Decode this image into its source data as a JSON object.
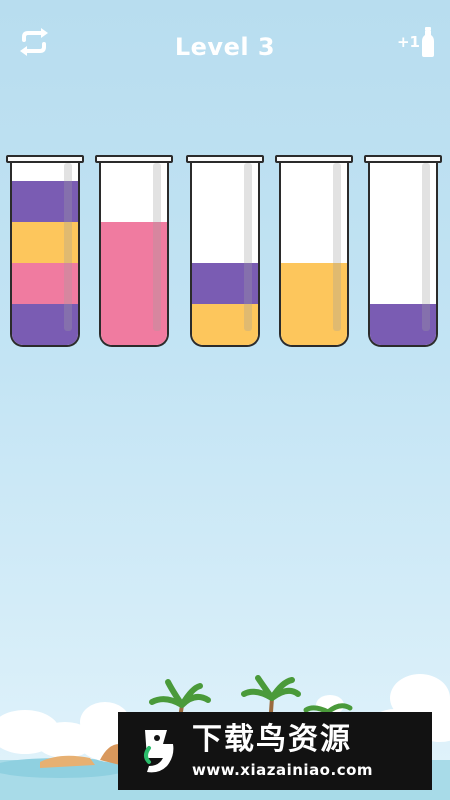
{
  "header": {
    "title": "Level 3",
    "add_tube_label": "+1",
    "restart_icon": "restart-icon",
    "bottle_icon": "bottle-icon"
  },
  "colors": {
    "purple": "#7a5cb3",
    "yellow": "#fdc65c",
    "pink": "#f07ba0",
    "empty": "#ffffff"
  },
  "tubes": [
    {
      "layers_bottom_to_top": [
        "purple",
        "pink",
        "yellow",
        "purple"
      ]
    },
    {
      "layers_bottom_to_top": [
        "pink",
        "pink",
        "pink"
      ]
    },
    {
      "layers_bottom_to_top": [
        "yellow",
        "purple"
      ]
    },
    {
      "layers_bottom_to_top": [
        "yellow",
        "yellow"
      ]
    },
    {
      "layers_bottom_to_top": [
        "purple"
      ]
    }
  ],
  "tube_capacity": 4,
  "watermark": {
    "title": "下载鸟资源",
    "url": "www.xiazainiao.com"
  }
}
